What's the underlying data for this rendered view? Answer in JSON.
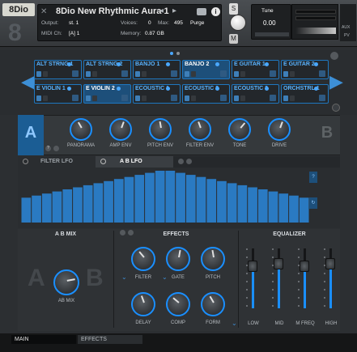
{
  "header": {
    "logo": "8Dio",
    "big_number": "8",
    "instrument_name": "8Dio New Rhythmic Aura 1",
    "output_label": "Output:",
    "output_value": "st. 1",
    "voices_label": "Voices:",
    "voices_value": "0",
    "max_label": "Max:",
    "max_value": "495",
    "purge_label": "Purge",
    "midi_label": "MIDI Ch:",
    "midi_value": "[A] 1",
    "memory_label": "Memory:",
    "memory_value": "0.87 GB",
    "tune_label": "Tune",
    "tune_value": "0.00",
    "s_label": "S",
    "m_label": "M",
    "aux_label": "AUX",
    "pv_label": "PV"
  },
  "slots": [
    {
      "label": "ALT STRNG 1"
    },
    {
      "label": "ALT STRNG 2"
    },
    {
      "label": "BANJO 1"
    },
    {
      "label": "BANJO 2"
    },
    {
      "label": "E GUITAR 1"
    },
    {
      "label": "E GUITAR 2"
    },
    {
      "label": "E VIOLIN 1"
    },
    {
      "label": "E VIOLIN 2"
    },
    {
      "label": "ECOUSTIC 1"
    },
    {
      "label": "ECOUSTIC 2"
    },
    {
      "label": "ECOUSTIC 3"
    },
    {
      "label": "ORCHSTRL 1"
    }
  ],
  "ab_panel": {
    "a_label": "A",
    "b_label": "B",
    "knobs": [
      {
        "label": "PANORAMA"
      },
      {
        "label": "AMP ENV"
      },
      {
        "label": "PITCH ENV"
      },
      {
        "label": "FILTER ENV"
      },
      {
        "label": "TONE"
      },
      {
        "label": "DRIVE"
      }
    ]
  },
  "lfo": {
    "tab1": "FILTER LFO",
    "tab2": "A B LFO",
    "side_top": "?",
    "side_bottom": "↻",
    "values": [
      0.48,
      0.52,
      0.56,
      0.6,
      0.64,
      0.68,
      0.72,
      0.76,
      0.8,
      0.84,
      0.88,
      0.92,
      0.96,
      1.0,
      1.0,
      0.96,
      0.92,
      0.88,
      0.84,
      0.8,
      0.76,
      0.72,
      0.68,
      0.64,
      0.6,
      0.56,
      0.52,
      0.48
    ]
  },
  "bottom": {
    "ab_mix_title": "A B MIX",
    "ab_mix_label": "AB MIX",
    "a_big": "A",
    "b_big": "B",
    "effects_title": "EFFECTS",
    "effects_knobs": [
      {
        "label": "FILTER"
      },
      {
        "label": "GATE"
      },
      {
        "label": "PITCH"
      },
      {
        "label": "DELAY"
      },
      {
        "label": "COMP"
      },
      {
        "label": "FORM"
      }
    ],
    "eq_title": "EQUALIZER",
    "eq_bands": [
      {
        "label": "LOW",
        "level": 0.7
      },
      {
        "label": "MID",
        "level": 0.75
      },
      {
        "label": "M FREQ",
        "level": 0.7
      },
      {
        "label": "HIGH",
        "level": 0.75
      }
    ]
  },
  "footer": {
    "tab_main": "MAIN",
    "tab_effects": "EFFECTS"
  }
}
